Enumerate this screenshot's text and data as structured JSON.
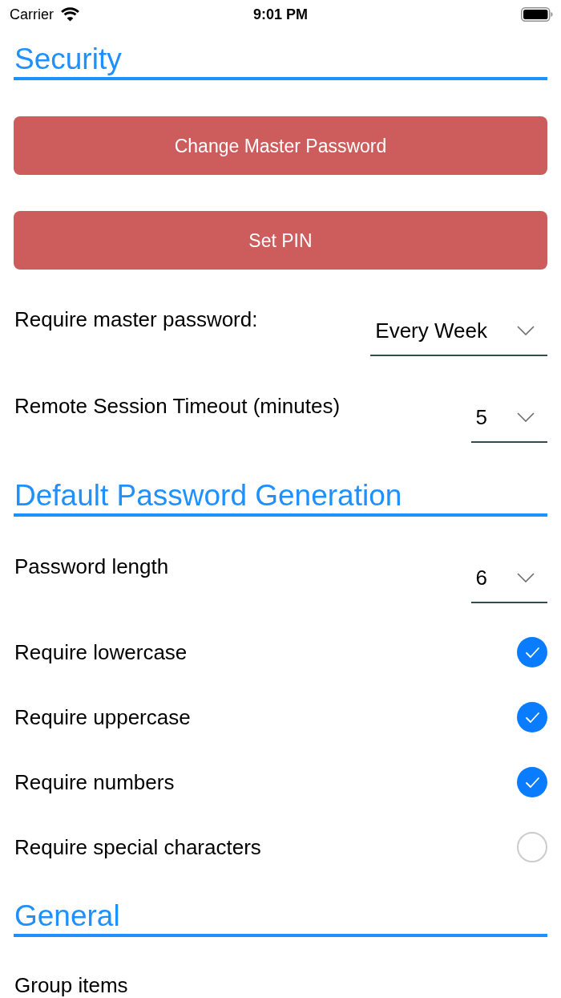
{
  "status_bar": {
    "carrier": "Carrier",
    "time": "9:01 PM"
  },
  "sections": [
    {
      "title": "Security",
      "items": [
        {
          "kind": "button",
          "label": "Change Master Password"
        },
        {
          "kind": "button",
          "label": "Set PIN"
        },
        {
          "kind": "dropdown",
          "label": "Require master password:",
          "value": "Every Week"
        },
        {
          "kind": "dropdown",
          "label": "Remote Session Timeout (minutes)",
          "value": "5"
        }
      ]
    },
    {
      "title": "Default Password Generation",
      "items": [
        {
          "kind": "dropdown",
          "label": "Password length",
          "value": "6"
        },
        {
          "kind": "checkbox",
          "label": "Require lowercase",
          "checked": true
        },
        {
          "kind": "checkbox",
          "label": "Require uppercase",
          "checked": true
        },
        {
          "kind": "checkbox",
          "label": "Require numbers",
          "checked": true
        },
        {
          "kind": "checkbox",
          "label": "Require special characters",
          "checked": false
        }
      ]
    },
    {
      "title": "General",
      "items": [
        {
          "kind": "setting",
          "label": "Group items"
        }
      ]
    }
  ]
}
